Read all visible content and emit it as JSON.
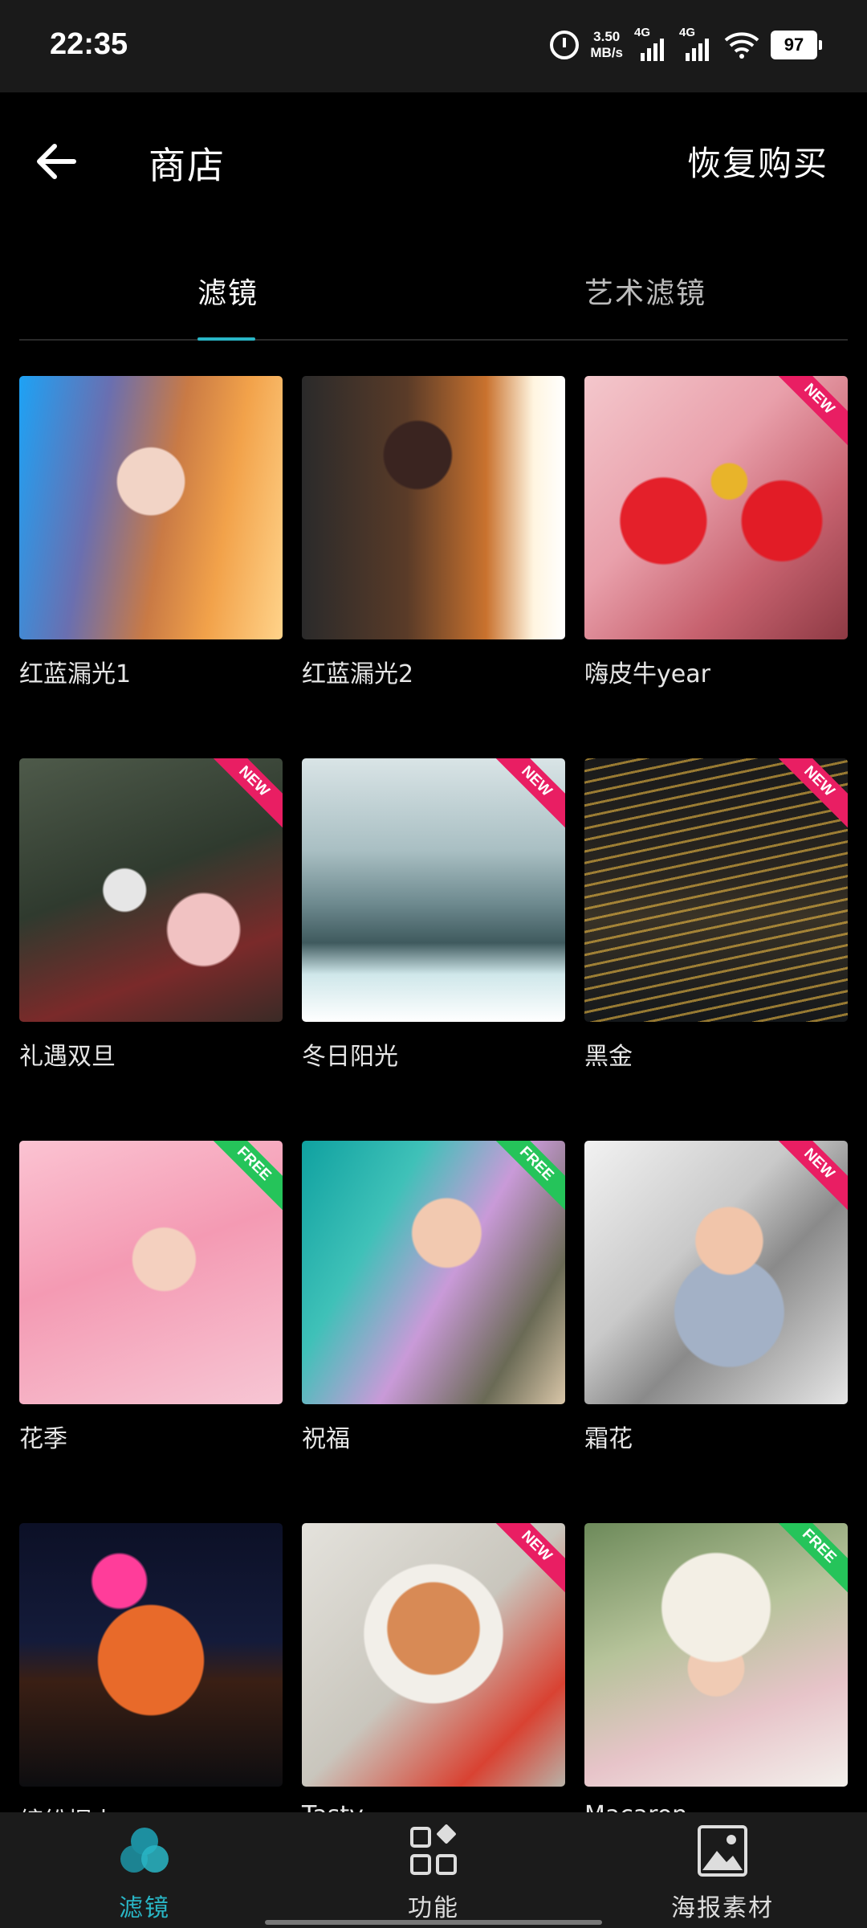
{
  "status_bar": {
    "time": "22:35",
    "net_speed_value": "3.50",
    "net_speed_unit": "MB/s",
    "sim1_label": "4G",
    "sim2_label": "4G",
    "battery": "97",
    "icons": [
      "alarm-icon",
      "signal-icon",
      "wifi-icon",
      "battery-icon"
    ]
  },
  "header": {
    "title": "商店",
    "restore_purchase": "恢复购买",
    "back_icon": "arrow-left-icon"
  },
  "tabs": [
    {
      "label": "滤镜",
      "active": true
    },
    {
      "label": "艺术滤镜",
      "active": false
    }
  ],
  "accent_color": "#29b6c6",
  "badge_colors": {
    "new": "#e91e63",
    "free": "#25c45a"
  },
  "items": [
    {
      "name": "红蓝漏光1",
      "badge": ""
    },
    {
      "name": "红蓝漏光2",
      "badge": ""
    },
    {
      "name": "嗨皮牛year",
      "badge": "NEW"
    },
    {
      "name": "礼遇双旦",
      "badge": "NEW"
    },
    {
      "name": "冬日阳光",
      "badge": "NEW"
    },
    {
      "name": "黑金",
      "badge": "NEW"
    },
    {
      "name": "花季",
      "badge": "FREE"
    },
    {
      "name": "祝福",
      "badge": "FREE"
    },
    {
      "name": "霜花",
      "badge": "NEW"
    },
    {
      "name": "缤纷烟火",
      "badge": ""
    },
    {
      "name": "Tasty",
      "badge": "NEW"
    },
    {
      "name": "Macaron",
      "badge": "FREE"
    }
  ],
  "bottom_nav": [
    {
      "label": "滤镜",
      "icon": "filter-circles-icon",
      "active": true
    },
    {
      "label": "功能",
      "icon": "grid-apps-icon",
      "active": false
    },
    {
      "label": "海报素材",
      "icon": "image-icon",
      "active": false
    }
  ]
}
